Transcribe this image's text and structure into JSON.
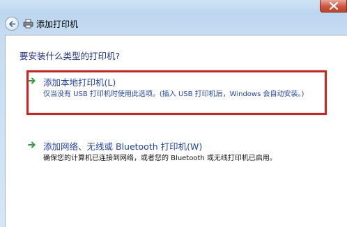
{
  "window": {
    "title": "添加打印机"
  },
  "main": {
    "question": "要安装什么类型的打印机?",
    "options": [
      {
        "title": "添加本地打印机(L)",
        "description": "仅当没有 USB 打印机时使用此选项。(插入 USB 打印机后，Windows 会自动安装。)"
      },
      {
        "title": "添加网络、无线或 Bluetooth 打印机(W)",
        "description": "确保您的计算机已连接到网络，或者您的 Bluetooth 或无线打印机已启用。"
      }
    ]
  },
  "colors": {
    "highlight": "#d81e1e",
    "link": "#1f44a8",
    "arrow": "#2e9d3a"
  },
  "icons": {
    "back": "back-arrow-icon",
    "printer": "printer-icon",
    "close": "close-icon",
    "option_arrow": "green-arrow-icon"
  }
}
